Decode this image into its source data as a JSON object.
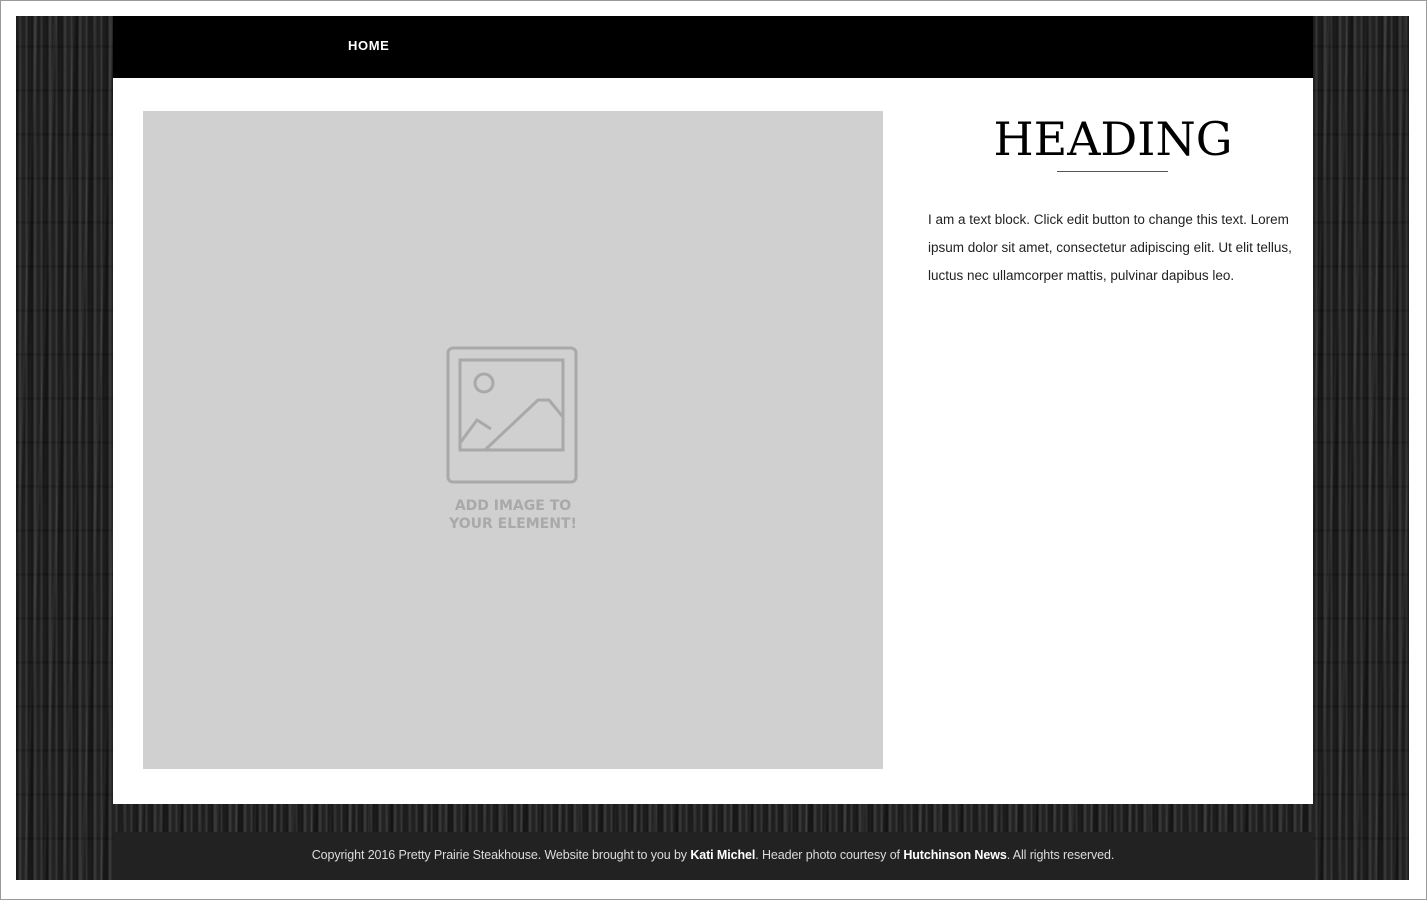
{
  "nav": {
    "items": [
      {
        "label": "HOME"
      }
    ]
  },
  "main": {
    "image_placeholder": {
      "icon": "image-placeholder-icon",
      "text": "ADD IMAGE TO\nYOUR ELEMENT!"
    },
    "heading": "HEADING",
    "text_block": "I am a text block. Click edit button to change this text. Lorem ipsum dolor sit amet, consectetur adipiscing elit. Ut elit tellus, luctus nec ullamcorper mattis, pulvinar dapibus leo."
  },
  "footer": {
    "part1": "Copyright 2016 Pretty Prairie Steakhouse. Website brought to you by ",
    "author": "Kati Michel",
    "part2": ". Header photo courtesy of ",
    "source": "Hutchinson News",
    "part3": ". All rights reserved."
  },
  "colors": {
    "nav_background": "#000000",
    "placeholder_background": "#d0d0d0",
    "footer_background": "#222222",
    "page_background": "#2b2b2b"
  }
}
